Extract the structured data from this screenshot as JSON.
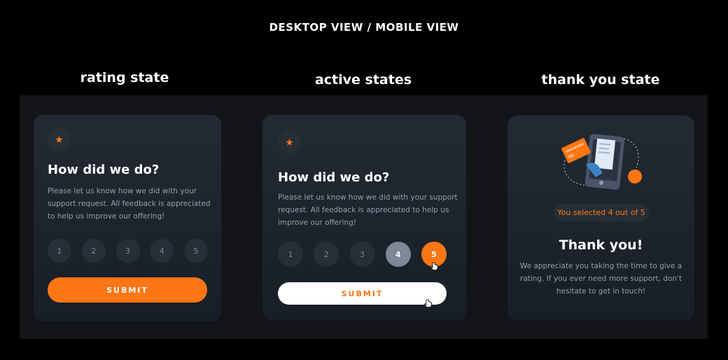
{
  "header": {
    "title": "DESKTOP VIEW / MOBILE VIEW"
  },
  "sections": {
    "rating": "rating state",
    "active": "active states",
    "thanks": "thank you state"
  },
  "rating_card": {
    "icon": "star-icon",
    "title": "How did we do?",
    "description_lines": [
      "Please let us know how we did with your",
      "support request. All feedback is appreciated",
      "to help us improve our offering!"
    ],
    "options": [
      "1",
      "2",
      "3",
      "4",
      "5"
    ],
    "submit_label": "SUBMIT"
  },
  "active_card": {
    "icon": "star-icon",
    "title": "How did we do?",
    "description_lines": [
      "Please let us know how we did with your support",
      "request. All feedback is appreciated to help us",
      "improve our offering!"
    ],
    "options": [
      "1",
      "2",
      "3",
      "4",
      "5"
    ],
    "hover_option": "4",
    "selected_option": "5",
    "submit_label": "SUBMIT"
  },
  "thanks_card": {
    "illustration": "phone-payment-illustration",
    "selected_text": "You selected 4 out of 5",
    "title": "Thank you!",
    "description_lines": [
      "We appreciate you taking the time to give a",
      "rating. If you ever need more support, don't",
      "hesitate to get in touch!"
    ]
  },
  "colors": {
    "accent": "#fc7614",
    "card_bg": "#1f2630",
    "stage_bg": "#131518",
    "muted_text": "#959eac",
    "circle_bg": "#262e38",
    "hover_gray": "#7c8798"
  }
}
